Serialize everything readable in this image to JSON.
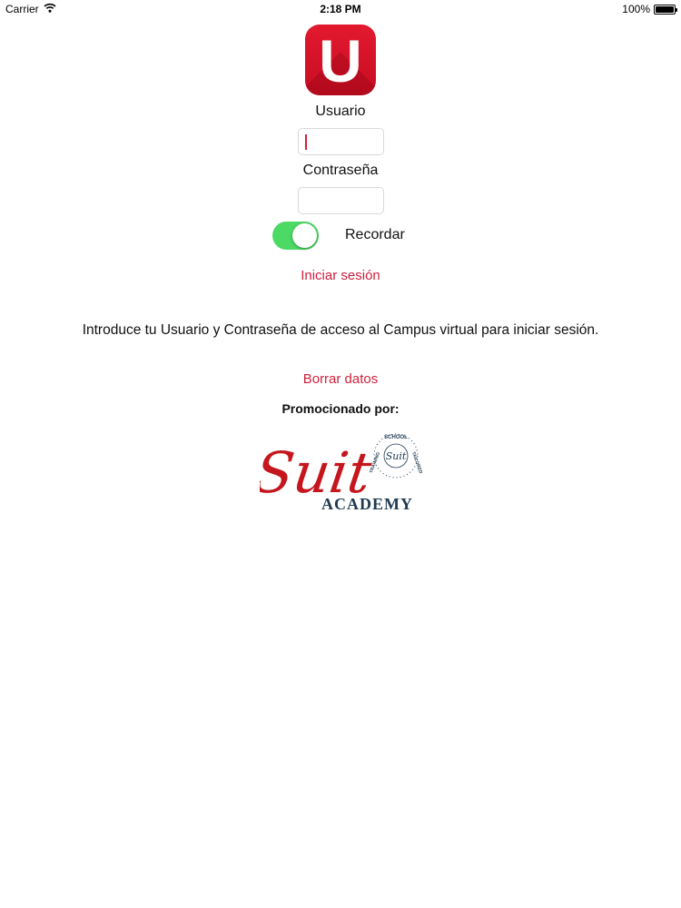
{
  "status": {
    "carrier": "Carrier",
    "time": "2:18 PM",
    "battery": "100%",
    "battery_level": 1.0
  },
  "app_icon_letter": "U",
  "form": {
    "username_label": "Usuario",
    "username_value": "",
    "password_label": "Contraseña",
    "password_value": "",
    "remember_label": "Recordar",
    "remember_on": true,
    "login_link": "Iniciar sesión"
  },
  "instructions": "Introduce tu Usuario y Contraseña de acceso al Campus virtual para iniciar sesión.",
  "clear_link": "Borrar datos",
  "promo_label": "Promocionado por:",
  "sponsor_logo": {
    "script": "Suit",
    "name": "ACADEMY",
    "seal_text": "TRAINING · SCHOOL · TAILORED",
    "seal_center": "Suit"
  },
  "colors": {
    "brand_red": "#d2213a",
    "link_red": "#cf1f3c",
    "toggle_green": "#4cd964",
    "logo_navy": "#1f3a52"
  }
}
